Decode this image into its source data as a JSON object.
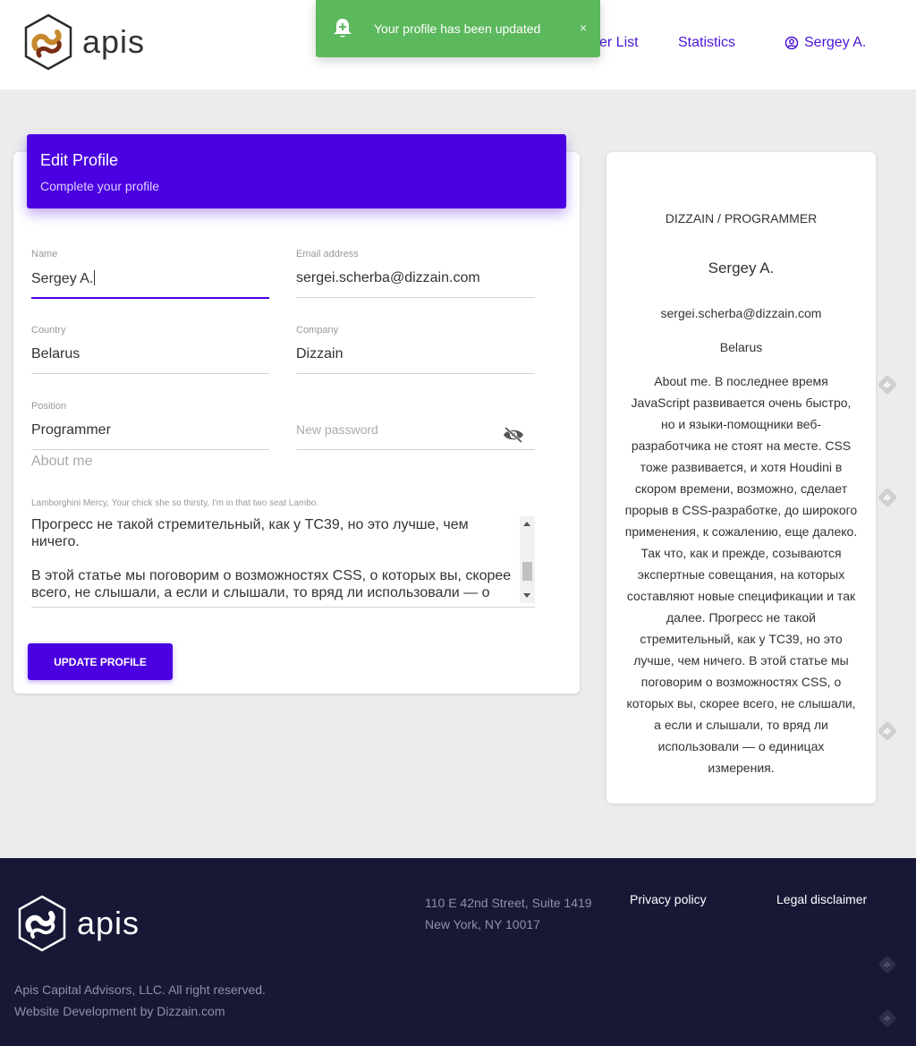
{
  "header": {
    "logo_text": "apis",
    "nav": {
      "user_list": "er List",
      "statistics": "Statistics",
      "user": "Sergey A."
    }
  },
  "toast": {
    "message": "Your profile has been updated",
    "close": "×"
  },
  "edit_profile": {
    "title": "Edit Profile",
    "subtitle": "Complete your profile",
    "fields": {
      "name": {
        "label": "Name",
        "value": "Sergey A."
      },
      "email": {
        "label": "Email address",
        "value": "sergei.scherba@dizzain.com"
      },
      "country": {
        "label": "Country",
        "value": "Belarus"
      },
      "company": {
        "label": "Company",
        "value": "Dizzain"
      },
      "position": {
        "label": "Position",
        "value": "Programmer"
      },
      "password": {
        "placeholder": "New password"
      }
    },
    "about_label": "About me",
    "about_sublabel": "Lamborghini Mercy, Your chick she so thirsty, I'm in that two seat Lambo.",
    "about_text": "Прогресс не такой стремительный, как у TC39, но это лучше, чем ничего.\n\nВ этой статье мы поговорим о возможностях CSS, о которых вы, скорее всего, не слышали, а если и слышали, то вряд ли использовали — о",
    "button": "UPDATE PROFILE"
  },
  "profile_card": {
    "role": "DIZZAIN / PROGRAMMER",
    "name": "Sergey A.",
    "email": "sergei.scherba@dizzain.com",
    "country": "Belarus",
    "about": "About me. В последнее время JavaScript развивается очень быстро, но и языки-помощники веб-разработчика не стоят на месте. CSS тоже развивается, и хотя Houdini в скором времени, возможно, сделает прорыв в CSS-разработке, до широкого применения, к сожалению, еще далеко. Так что, как и прежде, созываются экспертные совещания, на которых составляют новые спецификации и так далее. Прогресс не такой стремительный, как у TC39, но это лучше, чем ничего. В этой статье мы поговорим о возможностях CSS, о которых вы, скорее всего, не слышали, а если и слышали, то вряд ли использовали — о единицах измерения."
  },
  "footer": {
    "logo_text": "apis",
    "address_line1": "110 E 42nd Street, Suite 1419",
    "address_line2": "New York, NY 10017",
    "privacy": "Privacy policy",
    "legal": "Legal disclaimer",
    "copyright": "Apis Capital Advisors, LLC. All right reserved.",
    "dev": "Website Development by Dizzain.com"
  },
  "colors": {
    "accent": "#4a00e0",
    "toast": "#5cb85c",
    "footer": "#161835"
  },
  "icons": [
    "logo-icon",
    "bell-plus-icon",
    "close-icon",
    "user-circle-icon",
    "eye-off-icon",
    "feedback-icon"
  ]
}
